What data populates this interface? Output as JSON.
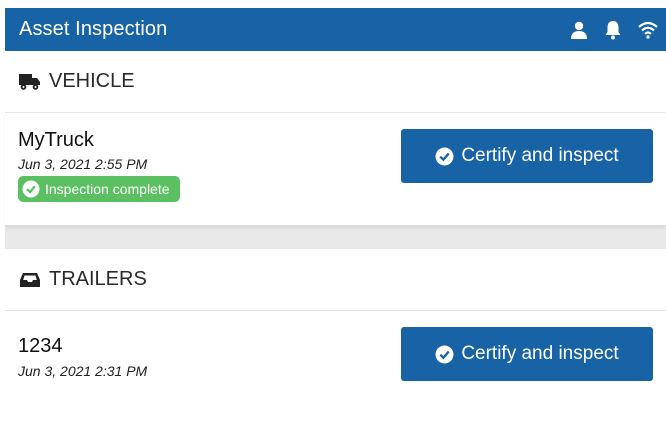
{
  "header": {
    "title": "Asset Inspection",
    "icons": [
      "user-icon",
      "bell-icon",
      "wifi-icon"
    ]
  },
  "vehicle": {
    "section_title": "VEHICLE",
    "section_icon": "truck-icon",
    "asset_name": "MyTruck",
    "timestamp": "Jun 3, 2021 2:55 PM",
    "status_badge": "Inspection complete",
    "button_label": "Certify and inspect"
  },
  "trailers": {
    "section_title": "TRAILERS",
    "section_icon": "inbox-icon",
    "items": [
      {
        "asset_name": "1234",
        "timestamp": "Jun 3, 2021 2:31 PM",
        "button_label": "Certify and inspect"
      }
    ]
  },
  "colors": {
    "primary": "#1763a6",
    "success": "#5ac061",
    "band": "#e9e9e9"
  }
}
